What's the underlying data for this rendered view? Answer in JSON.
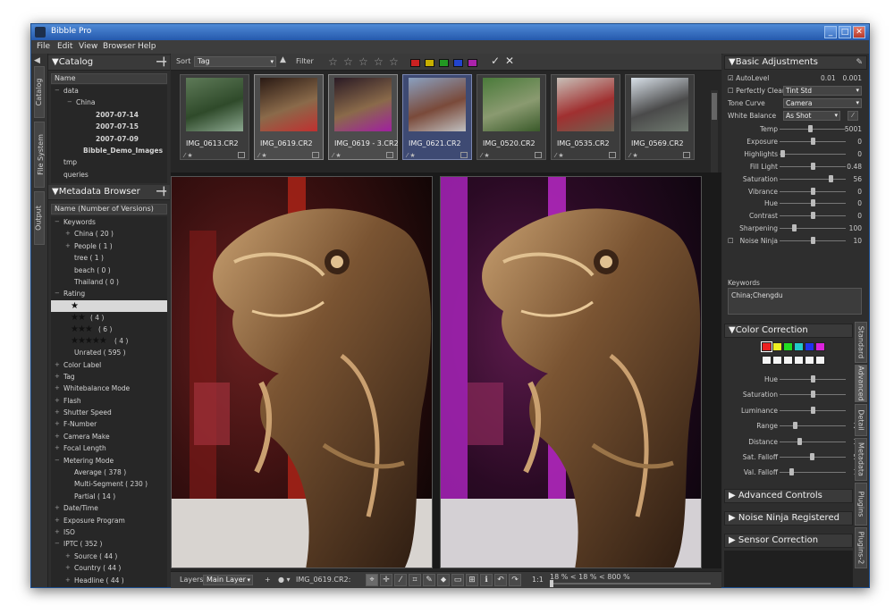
{
  "window": {
    "title": "Bibble Pro",
    "buttons": [
      "_",
      "□",
      "✕"
    ]
  },
  "menu": [
    "File",
    "Edit",
    "View",
    "Browser",
    "Help"
  ],
  "left_tabs": [
    "Catalog",
    "File System",
    "Output"
  ],
  "catalog": {
    "title": "Catalog",
    "column": "Name",
    "items": [
      {
        "label": "data",
        "indent": 0,
        "exp": "−",
        "bold": false
      },
      {
        "label": "China",
        "indent": 1,
        "exp": "−",
        "bold": false
      },
      {
        "label": "2007-07-14",
        "indent": 2,
        "exp": "",
        "bold": true
      },
      {
        "label": "2007-07-15",
        "indent": 2,
        "exp": "",
        "bold": true
      },
      {
        "label": "2007-07-09",
        "indent": 2,
        "exp": "",
        "bold": true
      },
      {
        "label": "Bibble_Demo_Images",
        "indent": 1,
        "exp": "",
        "bold": true
      },
      {
        "label": "tmp",
        "indent": 0,
        "exp": "",
        "bold": false
      },
      {
        "label": "queries",
        "indent": 0,
        "exp": "",
        "bold": false
      }
    ]
  },
  "metadata": {
    "title": "Metadata Browser",
    "column": "Name (Number of Versions)",
    "keywords": {
      "label": "Keywords",
      "items": [
        "China ( 20 )",
        "People ( 1 )",
        "tree ( 1 )",
        "beach ( 0 )",
        "Thailand ( 0 )"
      ]
    },
    "rating": {
      "label": "Rating",
      "rows": [
        {
          "stars": "★",
          "count": "",
          "selected": true
        },
        {
          "stars": "★★",
          "count": "( 4 )",
          "selected": false
        },
        {
          "stars": "★★★",
          "count": "( 6 )",
          "selected": false
        },
        {
          "stars": "★★★★★",
          "count": "( 4 )",
          "selected": false
        }
      ],
      "unrated": "Unrated ( 595 )"
    },
    "groups": [
      "Color Label",
      "Tag",
      "Whitebalance Mode",
      "Flash",
      "Shutter Speed",
      "F-Number",
      "Camera Make",
      "Focal Length"
    ],
    "metering": {
      "label": "Metering Mode",
      "items": [
        "Average ( 378 )",
        "Multi-Segment ( 230 )",
        "Partial ( 14 )"
      ]
    },
    "groups2": [
      "Date/Time",
      "Exposure Program",
      "ISO"
    ],
    "iptc": {
      "label": "IPTC ( 352 )",
      "items": [
        "Source ( 44 )",
        "Country ( 44 )",
        "Headline ( 44 )"
      ]
    }
  },
  "toolbar": {
    "sort_label": "Sort",
    "sort_value": "Tag",
    "filter_label": "Filter",
    "stars": [
      "☆",
      "☆",
      "☆",
      "☆",
      "☆"
    ],
    "color_labels": [
      "#cc2222",
      "#c8b000",
      "#229922",
      "#2244cc",
      "#aa22aa"
    ],
    "check": "✓",
    "cross": "✕"
  },
  "thumbnails": [
    {
      "name": "IMG_0613.CR2",
      "state": "normal",
      "colors": [
        "#5e7a58",
        "#2f4a2a",
        "#8ca890"
      ]
    },
    {
      "name": "IMG_0619.CR2",
      "state": "selected",
      "colors": [
        "#2a1a14",
        "#8a6a4a",
        "#c03030"
      ]
    },
    {
      "name": "IMG_0619 - 3.CR2",
      "state": "selected",
      "colors": [
        "#2a1a24",
        "#8a6a4a",
        "#a020a0"
      ]
    },
    {
      "name": "IMG_0621.CR2",
      "state": "active",
      "colors": [
        "#8aa0c0",
        "#7a4a3a",
        "#c0c0c0"
      ]
    },
    {
      "name": "IMG_0520.CR2",
      "state": "normal",
      "colors": [
        "#4a7a3a",
        "#8a9a70",
        "#3a5a2a"
      ]
    },
    {
      "name": "IMG_0535.CR2",
      "state": "normal",
      "colors": [
        "#c8c0b8",
        "#a03030",
        "#706050"
      ]
    },
    {
      "name": "IMG_0569.CR2",
      "state": "normal",
      "colors": [
        "#d8e0e8",
        "#4a4a4a",
        "#707a70"
      ]
    }
  ],
  "statusbar": {
    "layers_label": "Layers",
    "layer_value": "Main Layer",
    "file": "IMG_0619.CR2:",
    "ratio": "1:1",
    "zoom": "18 % < 18 % < 800 %",
    "tools": [
      "⌖",
      "✛",
      "⁄",
      "⌗",
      "✎",
      "⬥",
      "▭",
      "⊞",
      "ℹ",
      "↶",
      "↷"
    ]
  },
  "basic": {
    "title": "Basic Adjustments",
    "autolevel": {
      "label": "AutoLevel",
      "v1": "0.01",
      "v2": "0.001"
    },
    "perfectly_clear": {
      "label": "Perfectly Clear",
      "value": "Tint Std"
    },
    "tone_curve": {
      "label": "Tone Curve",
      "value": "Camera"
    },
    "white_balance": {
      "label": "White Balance",
      "value": "As Shot"
    },
    "sliders": [
      {
        "label": "Temp",
        "value": "5001",
        "pos": 0.45
      },
      {
        "label": "Exposure",
        "value": "0",
        "pos": 0.5
      },
      {
        "label": "Highlights",
        "value": "0",
        "pos": 0.02
      },
      {
        "label": "Fill Light",
        "value": "0.48",
        "pos": 0.5
      },
      {
        "label": "Saturation",
        "value": "56",
        "pos": 0.78
      },
      {
        "label": "Vibrance",
        "value": "0",
        "pos": 0.5
      },
      {
        "label": "Hue",
        "value": "0",
        "pos": 0.5
      },
      {
        "label": "Contrast",
        "value": "0",
        "pos": 0.5
      },
      {
        "label": "Sharpening",
        "value": "100",
        "pos": 0.2
      },
      {
        "label": "Noise Ninja",
        "value": "10",
        "pos": 0.5
      }
    ],
    "keywords_label": "Keywords",
    "keywords_value": "China;Chengdu"
  },
  "color_correction": {
    "title": "Color Correction",
    "swatches": [
      "#ee2222",
      "#eeee22",
      "#22dd22",
      "#22cccc",
      "#2233ee",
      "#dd22dd"
    ],
    "sliders": [
      {
        "label": "Hue",
        "value": "0",
        "pos": 0.5
      },
      {
        "label": "Saturation",
        "value": "0",
        "pos": 0.5
      },
      {
        "label": "Luminance",
        "value": "0",
        "pos": 0.5
      },
      {
        "label": "Range",
        "value": "20",
        "pos": 0.22
      },
      {
        "label": "Distance",
        "value": "30",
        "pos": 0.28
      },
      {
        "label": "Sat. Falloff",
        "value": "50",
        "pos": 0.48
      },
      {
        "label": "Val. Falloff",
        "value": "15",
        "pos": 0.16
      }
    ]
  },
  "collapsed_panels": [
    "Advanced Controls",
    "Noise Ninja Registered",
    "Sensor Correction"
  ],
  "right_tabs": [
    "Standard",
    "Advanced",
    "Detail",
    "Metadata",
    "Plugins",
    "Plugins-2"
  ]
}
